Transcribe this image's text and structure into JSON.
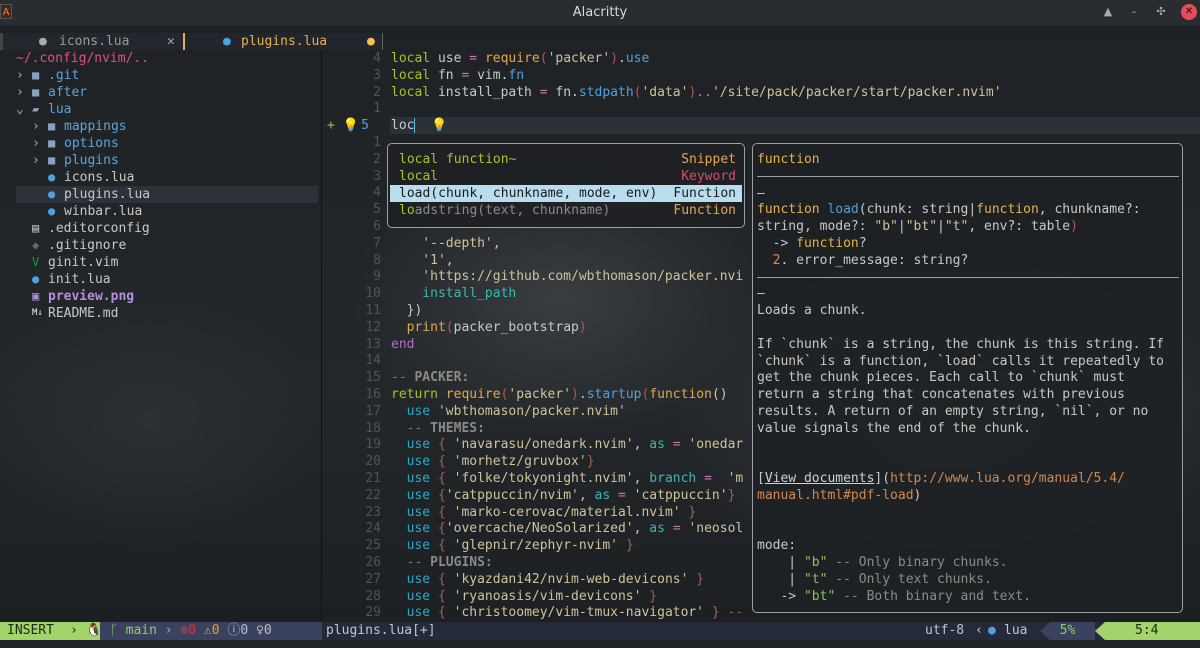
{
  "window": {
    "title": "Alacritty",
    "buttons": [
      "▲",
      "–",
      "✣",
      "✕"
    ]
  },
  "tabs": [
    {
      "label": "icons.lua",
      "icon": "lua-icon",
      "close": "✕",
      "active": false
    },
    {
      "label": "plugins.lua",
      "icon": "lua-icon",
      "modified": "●",
      "active": true
    }
  ],
  "sidebar": {
    "header": "~/.config/nvim/..",
    "items": [
      {
        "label": ".git",
        "type": "folder",
        "arrow": "›",
        "depth": 0
      },
      {
        "label": "after",
        "type": "folder",
        "arrow": "›",
        "depth": 0
      },
      {
        "label": "lua",
        "type": "folder-open",
        "arrow": "⌄",
        "depth": 0
      },
      {
        "label": "mappings",
        "type": "folder",
        "arrow": "›",
        "depth": 1
      },
      {
        "label": "options",
        "type": "folder",
        "arrow": "›",
        "depth": 1
      },
      {
        "label": "plugins",
        "type": "folder",
        "arrow": "›",
        "depth": 1
      },
      {
        "label": "icons.lua",
        "type": "lua",
        "depth": 1
      },
      {
        "label": "plugins.lua",
        "type": "lua",
        "depth": 1,
        "selected": true
      },
      {
        "label": "winbar.lua",
        "type": "lua",
        "depth": 1
      },
      {
        "label": ".editorconfig",
        "type": "file",
        "depth": 0
      },
      {
        "label": ".gitignore",
        "type": "git",
        "depth": 0
      },
      {
        "label": "ginit.vim",
        "type": "vim",
        "depth": 0
      },
      {
        "label": "init.lua",
        "type": "lua",
        "depth": 0
      },
      {
        "label": "preview.png",
        "type": "image",
        "depth": 0
      },
      {
        "label": "README.md",
        "type": "markdown",
        "depth": 0
      }
    ]
  },
  "editor": {
    "current_line_prefix": "+ 💡",
    "lines": [
      {
        "n": "4",
        "tok": [
          [
            "local",
            "kw"
          ],
          [
            " use ",
            "pl"
          ],
          [
            "=",
            "op"
          ],
          [
            " ",
            "pl"
          ],
          [
            "require",
            "fn"
          ],
          [
            "(",
            "par"
          ],
          [
            "'packer'",
            "str"
          ],
          [
            ")",
            "par"
          ],
          [
            ".",
            "pl"
          ],
          [
            "use",
            "prop"
          ]
        ]
      },
      {
        "n": "3",
        "tok": [
          [
            "local",
            "kw"
          ],
          [
            " fn ",
            "pl"
          ],
          [
            "=",
            "op"
          ],
          [
            " vim.",
            "pl"
          ],
          [
            "fn",
            "prop"
          ]
        ]
      },
      {
        "n": "2",
        "tok": [
          [
            "local",
            "kw"
          ],
          [
            " install_path ",
            "pl"
          ],
          [
            "=",
            "op"
          ],
          [
            " fn.",
            "pl"
          ],
          [
            "stdpath",
            "prop"
          ],
          [
            "(",
            "par"
          ],
          [
            "'data'",
            "str"
          ],
          [
            ")",
            "par"
          ],
          [
            "..",
            "op"
          ],
          [
            "'/site/pack/packer/start/packer.nvim'",
            "str"
          ]
        ]
      },
      {
        "n": "1",
        "tok": []
      },
      {
        "n": "5",
        "tok": [
          [
            "loc",
            "pl"
          ]
        ],
        "current": true
      },
      {
        "n": "1",
        "tok": []
      },
      {
        "n": "2",
        "tok": []
      },
      {
        "n": "3",
        "tok": []
      },
      {
        "n": "4",
        "tok": []
      },
      {
        "n": "5",
        "tok": []
      },
      {
        "n": "6",
        "tok": []
      },
      {
        "n": "7",
        "tok": [
          [
            "    '--depth',",
            "str"
          ]
        ]
      },
      {
        "n": "8",
        "tok": [
          [
            "    '1',",
            "str"
          ]
        ]
      },
      {
        "n": "9",
        "tok": [
          [
            "    'https://github.com/wbthomason/packer.nvi",
            "str"
          ]
        ]
      },
      {
        "n": "10",
        "tok": [
          [
            "    install_path",
            "teal"
          ]
        ]
      },
      {
        "n": "11",
        "tok": [
          [
            "  })",
            "pl"
          ]
        ]
      },
      {
        "n": "12",
        "tok": [
          [
            "  ",
            "pl"
          ],
          [
            "print",
            "fn"
          ],
          [
            "(",
            "par"
          ],
          [
            "packer_bootstrap",
            "pl"
          ],
          [
            ")",
            "par"
          ]
        ]
      },
      {
        "n": "13",
        "tok": [
          [
            "end",
            "purp"
          ]
        ]
      },
      {
        "n": "14",
        "tok": []
      },
      {
        "n": "15",
        "tok": [
          [
            "-- ",
            "cm"
          ],
          [
            "PACKER:",
            "cmb"
          ]
        ]
      },
      {
        "n": "16",
        "tok": [
          [
            "return",
            "kw"
          ],
          [
            " ",
            "pl"
          ],
          [
            "require",
            "fn"
          ],
          [
            "(",
            "par"
          ],
          [
            "'packer'",
            "str"
          ],
          [
            ")",
            "par"
          ],
          [
            ".",
            "pl"
          ],
          [
            "startup",
            "prop"
          ],
          [
            "(",
            "par"
          ],
          [
            "function",
            "fn"
          ],
          [
            "()",
            "pl"
          ]
        ]
      },
      {
        "n": "17",
        "tok": [
          [
            "  ",
            "pl"
          ],
          [
            "use",
            "use"
          ],
          [
            " 'wbthomason/packer.nvim'",
            "str"
          ]
        ]
      },
      {
        "n": "18",
        "tok": [
          [
            "  -- ",
            "cm"
          ],
          [
            "THEMES:",
            "cmb"
          ]
        ]
      },
      {
        "n": "19",
        "tok": [
          [
            "  ",
            "pl"
          ],
          [
            "use",
            "use"
          ],
          [
            " { ",
            "br"
          ],
          [
            "'navarasu/onedark.nvim'",
            "str"
          ],
          [
            ", ",
            "pl"
          ],
          [
            "as",
            "teal"
          ],
          [
            " = ",
            "op"
          ],
          [
            "'onedar",
            "str"
          ]
        ]
      },
      {
        "n": "20",
        "tok": [
          [
            "  ",
            "pl"
          ],
          [
            "use",
            "use"
          ],
          [
            " { ",
            "br"
          ],
          [
            "'morhetz/gruvbox'",
            "str"
          ],
          [
            "}",
            "br"
          ]
        ]
      },
      {
        "n": "21",
        "tok": [
          [
            "  ",
            "pl"
          ],
          [
            "use",
            "use"
          ],
          [
            " { ",
            "br"
          ],
          [
            "'folke/tokyonight.nvim'",
            "str"
          ],
          [
            ", ",
            "pl"
          ],
          [
            "branch",
            "teal"
          ],
          [
            " =  ",
            "op"
          ],
          [
            "'m",
            "str"
          ]
        ]
      },
      {
        "n": "22",
        "tok": [
          [
            "  ",
            "pl"
          ],
          [
            "use",
            "use"
          ],
          [
            " {",
            "br"
          ],
          [
            "'catppuccin/nvim'",
            "str"
          ],
          [
            ", ",
            "pl"
          ],
          [
            "as",
            "teal"
          ],
          [
            " = ",
            "op"
          ],
          [
            "'catppuccin'",
            "str"
          ],
          [
            "}",
            "br"
          ]
        ]
      },
      {
        "n": "23",
        "tok": [
          [
            "  ",
            "pl"
          ],
          [
            "use",
            "use"
          ],
          [
            " { ",
            "br"
          ],
          [
            "'marko-cerovac/material.nvim'",
            "str"
          ],
          [
            " }",
            "br"
          ]
        ]
      },
      {
        "n": "24",
        "tok": [
          [
            "  ",
            "pl"
          ],
          [
            "use",
            "use"
          ],
          [
            " {",
            "br"
          ],
          [
            "'overcache/NeoSolarized'",
            "str"
          ],
          [
            ", ",
            "pl"
          ],
          [
            "as",
            "teal"
          ],
          [
            " = ",
            "op"
          ],
          [
            "'neosol",
            "str"
          ]
        ]
      },
      {
        "n": "25",
        "tok": [
          [
            "  ",
            "pl"
          ],
          [
            "use",
            "use"
          ],
          [
            " { ",
            "br"
          ],
          [
            "'glepnir/zephyr-nvim'",
            "str"
          ],
          [
            " }",
            "br"
          ]
        ]
      },
      {
        "n": "26",
        "tok": [
          [
            "  -- ",
            "cm"
          ],
          [
            "PLUGINS:",
            "cmb"
          ]
        ]
      },
      {
        "n": "27",
        "tok": [
          [
            "  ",
            "pl"
          ],
          [
            "use",
            "use"
          ],
          [
            " { ",
            "br"
          ],
          [
            "'kyazdani42/nvim-web-devicons'",
            "str"
          ],
          [
            " }",
            "br"
          ]
        ]
      },
      {
        "n": "28",
        "tok": [
          [
            "  ",
            "pl"
          ],
          [
            "use",
            "use"
          ],
          [
            " { ",
            "br"
          ],
          [
            "'ryanoasis/vim-devicons'",
            "str"
          ],
          [
            " }",
            "br"
          ]
        ]
      },
      {
        "n": "29",
        "tok": [
          [
            "  ",
            "pl"
          ],
          [
            "use",
            "use"
          ],
          [
            " { ",
            "br"
          ],
          [
            "'christoomey/vim-tmux-navigator'",
            "str"
          ],
          [
            " } --",
            "br"
          ]
        ]
      }
    ]
  },
  "completion": {
    "items": [
      {
        "label": "local function~",
        "kind": "Snippet",
        "kind_color": "#e0a84c"
      },
      {
        "label": "local",
        "kind": "Keyword",
        "kind_color": "#d84a6a"
      },
      {
        "label": "load(chunk, chunkname, mode, env)",
        "kind": "Function",
        "kind_color": "#1a1a1a",
        "selected": true
      },
      {
        "label": "loadstring(text, chunkname)",
        "kind": "Function",
        "kind_color": "#e0a84c"
      }
    ]
  },
  "docs": {
    "rows": [
      [
        [
          "function",
          "y"
        ]
      ],
      "hr",
      [
        [
          "—",
          "pl"
        ]
      ],
      [
        [
          "function",
          "y"
        ],
        [
          " ",
          "pl"
        ],
        [
          "load",
          "prop"
        ],
        [
          "(chunk: string|",
          "pl"
        ],
        [
          "function",
          "y"
        ],
        [
          ", chunkname?:",
          "pl"
        ]
      ],
      [
        [
          "string, mode?: ",
          "pl"
        ],
        [
          "\"b\"",
          "str"
        ],
        [
          "|",
          "pl"
        ],
        [
          "\"bt\"",
          "str"
        ],
        [
          "|",
          "pl"
        ],
        [
          "\"t\"",
          "str"
        ],
        [
          ", env?: table",
          "pl"
        ],
        [
          ")",
          "par"
        ]
      ],
      [
        [
          "  -> ",
          "pl"
        ],
        [
          "function",
          "y"
        ],
        [
          "?",
          "pl"
        ]
      ],
      [
        [
          "  ",
          "pl"
        ],
        [
          "2",
          "or"
        ],
        [
          ". error_message: string?",
          "pl"
        ]
      ],
      "hr",
      [
        [
          "—",
          "pl"
        ]
      ],
      [
        [
          "Loads a chunk.",
          "pl"
        ]
      ],
      [],
      [
        [
          "If `chunk` is a string, the chunk is this string. If",
          "pl"
        ]
      ],
      [
        [
          "`chunk` is a function, `load` calls it repeatedly to",
          "pl"
        ]
      ],
      [
        [
          "get the chunk pieces. Each call to `chunk` must",
          "pl"
        ]
      ],
      [
        [
          "return a string that concatenates with previous",
          "pl"
        ]
      ],
      [
        [
          "results. A return of an empty string, `nil`, or no",
          "pl"
        ]
      ],
      [
        [
          "value signals the end of the chunk.",
          "pl"
        ]
      ],
      [],
      [],
      [
        [
          "[",
          "pl"
        ],
        [
          "View documents",
          "lnk"
        ],
        [
          "](",
          "pl"
        ],
        [
          "http://www.lua.org/manual/5.4/",
          "url"
        ]
      ],
      [
        [
          "manual.html#pdf-load",
          "url"
        ],
        [
          ")",
          "pl"
        ]
      ],
      [],
      [],
      [
        [
          "mode:",
          "pl"
        ]
      ],
      [
        [
          "    | ",
          "pl"
        ],
        [
          "\"b\"",
          "grn"
        ],
        [
          " -- Only binary chunks.",
          "dim"
        ]
      ],
      [
        [
          "    | ",
          "pl"
        ],
        [
          "\"t\"",
          "grn"
        ],
        [
          " -- Only text chunks.",
          "dim"
        ]
      ],
      [
        [
          "   -> ",
          "pl"
        ],
        [
          "\"bt\"",
          "grn"
        ],
        [
          " -- Both binary and text.",
          "dim"
        ]
      ]
    ]
  },
  "statusline": {
    "mode": "INSERT",
    "os_icon": "linux-icon",
    "branch": "main",
    "errors": "0",
    "warnings": "0",
    "info": "0",
    "hints": "0",
    "file": "plugins.lua[+]",
    "encoding": "utf-8",
    "filetype": "lua",
    "percent": "5%",
    "position": "5:4",
    "colors": {
      "mode_bg": "#a3d36b",
      "section_bg": "#4b5374",
      "bar_bg": "#252a3a"
    }
  }
}
